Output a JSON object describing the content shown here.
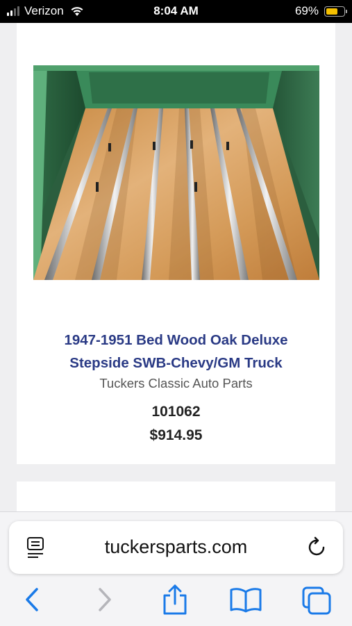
{
  "status_bar": {
    "carrier": "Verizon",
    "time": "8:04 AM",
    "battery_percent": "69%",
    "battery_level": 0.69,
    "icons": [
      "signal-icon",
      "wifi-icon",
      "battery-icon"
    ]
  },
  "product": {
    "image_alt": "Chevy/GM truck bed with oak bed wood planks and stainless strips",
    "title": "1947-1951 Bed Wood Oak Deluxe Stepside SWB-Chevy/GM Truck",
    "vendor": "Tuckers Classic Auto Parts",
    "sku": "101062",
    "price": "$914.95"
  },
  "browser": {
    "url": "tuckersparts.com",
    "icons": [
      "reader-icon",
      "reload-icon",
      "back-icon",
      "forward-icon",
      "share-icon",
      "bookmarks-icon",
      "tabs-icon"
    ]
  },
  "colors": {
    "title": "#2a3a85",
    "accent": "#1a7ae8",
    "battery": "#f5c000"
  }
}
